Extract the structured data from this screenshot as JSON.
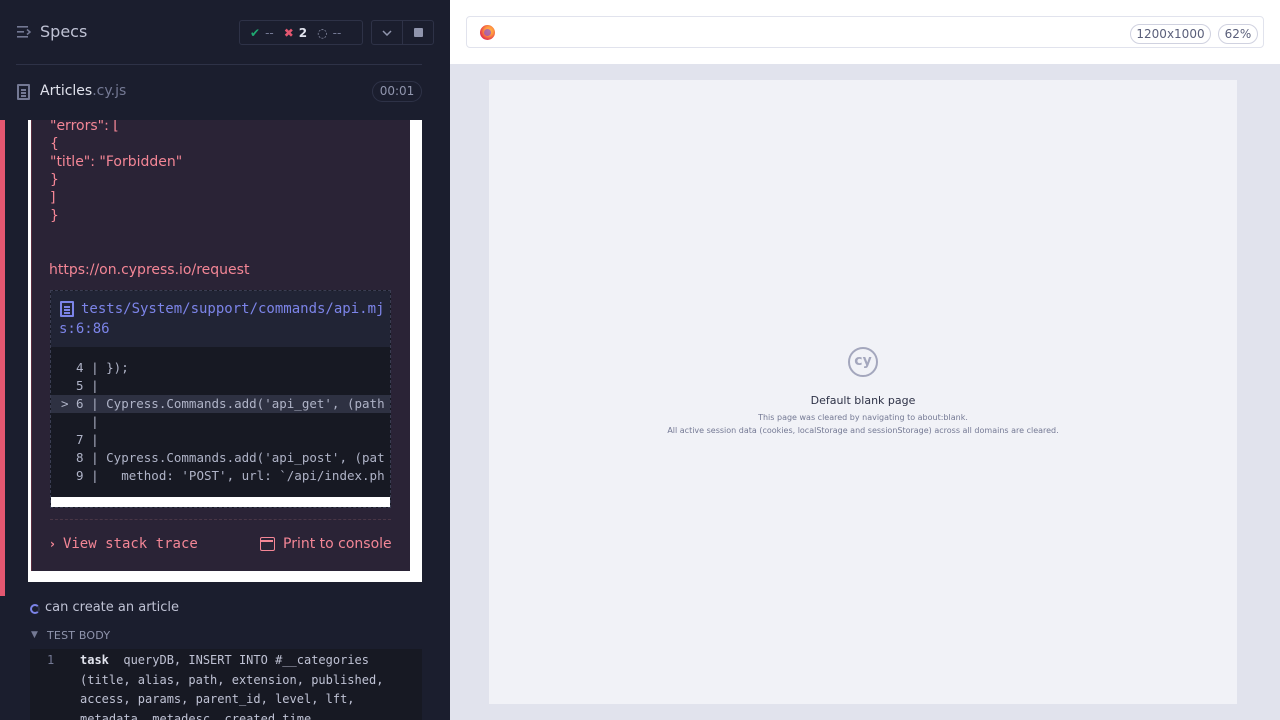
{
  "reporter": {
    "header_title": "Specs",
    "stats": {
      "passed": "--",
      "failed": "2",
      "pending": "--"
    },
    "spec": {
      "name": "Articles",
      "ext": ".cy.js",
      "duration": "00:01"
    },
    "error": {
      "json_lines": [
        "\"errors\": [",
        "{",
        "\"title\": \"Forbidden\"",
        "}",
        "]",
        "}"
      ],
      "docs_link": "https://on.cypress.io/request",
      "code_frame": {
        "file_path": "tests/System/support/commands/api.mjs:6:86",
        "lines": [
          "  4 | });",
          "  5 | ",
          "> 6 | Cypress.Commands.add('api_get', (path",
          "    | ",
          "  7 | ",
          "  8 | Cypress.Commands.add('api_post', (pat",
          "  9 |   method: 'POST', url: `/api/index.ph"
        ]
      },
      "view_stack_trace": "View stack trace",
      "print_to_console": "Print to console"
    },
    "next_test": {
      "title": "can create an article",
      "section": "TEST BODY",
      "command": {
        "number": "1",
        "name": "task",
        "message": "queryDB, INSERT INTO #__categories (title, alias, path, extension, published, access, params, parent_id, level, lft, metadata, metadesc, created_time,"
      }
    }
  },
  "aut": {
    "viewport_size": "1200x1000",
    "zoom": "62%",
    "blank_page": {
      "logo_text": "cy",
      "title": "Default blank page",
      "line1": "This page was cleared by navigating to about:blank.",
      "line2": "All active session data (cookies, localStorage and sessionStorage) across all domains are cleared."
    }
  },
  "icons": [
    "specs-list-icon",
    "check-icon",
    "x-icon",
    "spinner-icon",
    "chevron-down-icon",
    "stop-icon",
    "file-icon",
    "chevron-right-icon",
    "console-icon",
    "firefox-icon",
    "cypress-logo"
  ],
  "colors": {
    "fail": "#e45770",
    "pass": "#1fa971",
    "link": "#7c84e8",
    "error_text": "#f48696"
  }
}
